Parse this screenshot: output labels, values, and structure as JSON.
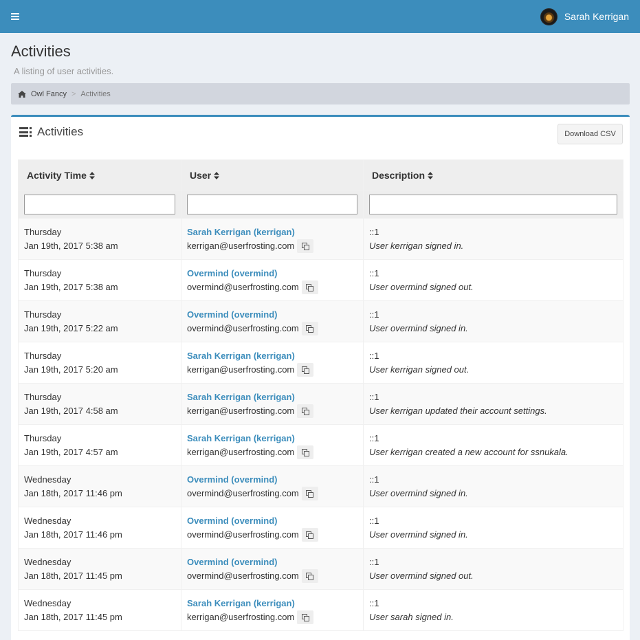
{
  "topbar": {
    "user_name": "Sarah Kerrigan",
    "menu_icon": "bars-icon",
    "avatar": "user-avatar"
  },
  "page": {
    "title": "Activities",
    "subtitle": "A listing of user activities."
  },
  "breadcrumb": {
    "home_icon": "home-icon",
    "home": "Owl Fancy",
    "separator": ">",
    "current": "Activities"
  },
  "box": {
    "title": "Activities",
    "icon": "list-icon",
    "download_label": "Download CSV"
  },
  "colors": {
    "accent": "#3c8dbc",
    "breadcrumb_bg": "#d2d6de",
    "page_bg": "#ecf0f5"
  },
  "table": {
    "columns": [
      "Activity Time",
      "User",
      "Description"
    ],
    "filters": [
      "",
      "",
      ""
    ],
    "rows": [
      {
        "day": "Thursday",
        "date": "Jan 19th, 2017 5:38 am",
        "user": "Sarah Kerrigan (kerrigan)",
        "email": "kerrigan@userfrosting.com",
        "ip": "::1",
        "description": "User kerrigan signed in."
      },
      {
        "day": "Thursday",
        "date": "Jan 19th, 2017 5:38 am",
        "user": "Overmind (overmind)",
        "email": "overmind@userfrosting.com",
        "ip": "::1",
        "description": "User overmind signed out."
      },
      {
        "day": "Thursday",
        "date": "Jan 19th, 2017 5:22 am",
        "user": "Overmind (overmind)",
        "email": "overmind@userfrosting.com",
        "ip": "::1",
        "description": "User overmind signed in."
      },
      {
        "day": "Thursday",
        "date": "Jan 19th, 2017 5:20 am",
        "user": "Sarah Kerrigan (kerrigan)",
        "email": "kerrigan@userfrosting.com",
        "ip": "::1",
        "description": "User kerrigan signed out."
      },
      {
        "day": "Thursday",
        "date": "Jan 19th, 2017 4:58 am",
        "user": "Sarah Kerrigan (kerrigan)",
        "email": "kerrigan@userfrosting.com",
        "ip": "::1",
        "description": "User kerrigan updated their account settings."
      },
      {
        "day": "Thursday",
        "date": "Jan 19th, 2017 4:57 am",
        "user": "Sarah Kerrigan (kerrigan)",
        "email": "kerrigan@userfrosting.com",
        "ip": "::1",
        "description": "User kerrigan created a new account for ssnukala."
      },
      {
        "day": "Wednesday",
        "date": "Jan 18th, 2017 11:46 pm",
        "user": "Overmind (overmind)",
        "email": "overmind@userfrosting.com",
        "ip": "::1",
        "description": "User overmind signed in."
      },
      {
        "day": "Wednesday",
        "date": "Jan 18th, 2017 11:46 pm",
        "user": "Overmind (overmind)",
        "email": "overmind@userfrosting.com",
        "ip": "::1",
        "description": "User overmind signed in."
      },
      {
        "day": "Wednesday",
        "date": "Jan 18th, 2017 11:45 pm",
        "user": "Overmind (overmind)",
        "email": "overmind@userfrosting.com",
        "ip": "::1",
        "description": "User overmind signed out."
      },
      {
        "day": "Wednesday",
        "date": "Jan 18th, 2017 11:45 pm",
        "user": "Sarah Kerrigan (kerrigan)",
        "email": "kerrigan@userfrosting.com",
        "ip": "::1",
        "description": "User sarah signed in."
      }
    ]
  }
}
